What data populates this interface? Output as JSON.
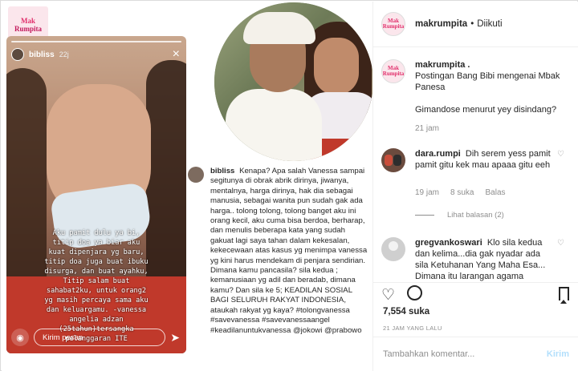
{
  "logo": {
    "line1": "Mak",
    "line2": "Rumpita"
  },
  "story": {
    "username": "bibliss",
    "time": "22j",
    "close_icon": "×",
    "caption": "Aku pamit dulu ya bi,\ntitip doa ya biar aku\nkuat dipenjara yg baru,\ntitip doa juga buat ibuku\ndisurga, dan buat ayahku,\nTitip salam buat\nsahabat2ku, untuk orang2\nyg masih percaya sama aku\ndan keluargamu. -vanessa\nangelia adzan\n(25tahun)tersangka\npelanggaran ITE",
    "reply_placeholder": "Kirim pesan"
  },
  "image_comment": {
    "username": "bibliss",
    "text": "Kenapa? Apa salah Vanessa sampai segitunya di obrak abrik dirinya, jiwanya, mentalnya, harga dirinya, hak dia sebagai manusia, sebagai wanita pun sudah gak ada harga.. tolong tolong, tolong banget aku ini orang kecil, aku cuma bisa berdoa, berharap, dan menulis beberapa kata yang sudah gakuat lagi saya tahan dalam kekesalan, kekecewaan atas kasus yg menimpa vanessa yg kini harus mendekam di penjara sendirian. Dimana kamu pancasila? sila kedua ; kemanusiaan yg adil dan beradab, dimana kamu? Dan sila ke 5; KEADILAN SOSIAL BAGI SELURUH RAKYAT INDONESIA, ataukah rakyat yg kaya? #tolongvanessa #savevanessa #savevanessaangel #keadilanuntukvanessa @jokowi @prabowo"
  },
  "header": {
    "avatar_text": "Mak Rumpita",
    "username": "makrumpita",
    "separator": "•",
    "follow_status": "Diikuti"
  },
  "comments": [
    {
      "username": "makrumpita .",
      "text": "Postingan Bang Bibi mengenai Mbak Panesa\n\nGimandose menurut yey disindang?",
      "time": "21 jam"
    },
    {
      "username": "dara.rumpi",
      "text": "Dih serem yess pamit pamit gitu kek mau apaaa gitu eeh",
      "time": "19 jam",
      "likes": "8 suka",
      "reply": "Balas",
      "view_replies": "Lihat balasan (2)"
    },
    {
      "username": "gregvankoswari",
      "text": "Klo sila kedua dan kelima...dia gak nyadar ada sila Ketuhanan Yang Maha Esa... Dimana itu larangan agama"
    }
  ],
  "actions": {
    "likes": "7,554 suka",
    "date": "21 JAM YANG LALU"
  },
  "add_comment": {
    "placeholder": "Tambahkan komentar...",
    "submit": "Kirim"
  },
  "icons": {
    "heart": "heart-icon",
    "comment": "comment-icon",
    "save": "bookmark-icon",
    "camera": "camera-icon",
    "send": "send-icon"
  }
}
